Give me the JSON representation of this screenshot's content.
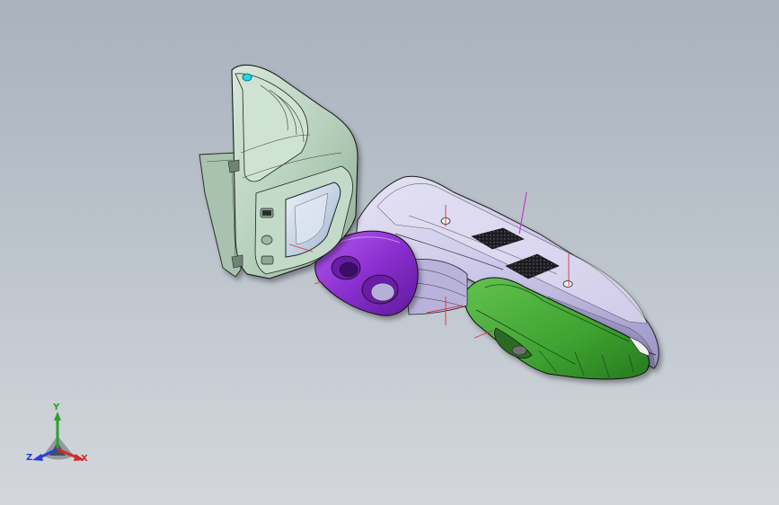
{
  "viewport": {
    "background_top": "#a9b2bd",
    "background_bottom": "#d3d7dc"
  },
  "model": {
    "parts": [
      {
        "name": "rear-housing",
        "color": "#b9d3bf"
      },
      {
        "name": "front-body",
        "color": "#c8c3e6"
      },
      {
        "name": "grip-ring",
        "color": "#8a2fd0"
      },
      {
        "name": "handle-cover",
        "color": "#3fa531"
      }
    ],
    "vent_color": "#2a2a2e",
    "edge_color": "#1c1c1c",
    "reference_axis_color": "#e0303a",
    "sketch_line_color": "#c53cd0"
  },
  "triad": {
    "x_label": "X",
    "y_label": "Y",
    "z_label": "Z",
    "x_color": "#d42a2a",
    "y_color": "#2ca02c",
    "z_color": "#2b3fd4"
  }
}
